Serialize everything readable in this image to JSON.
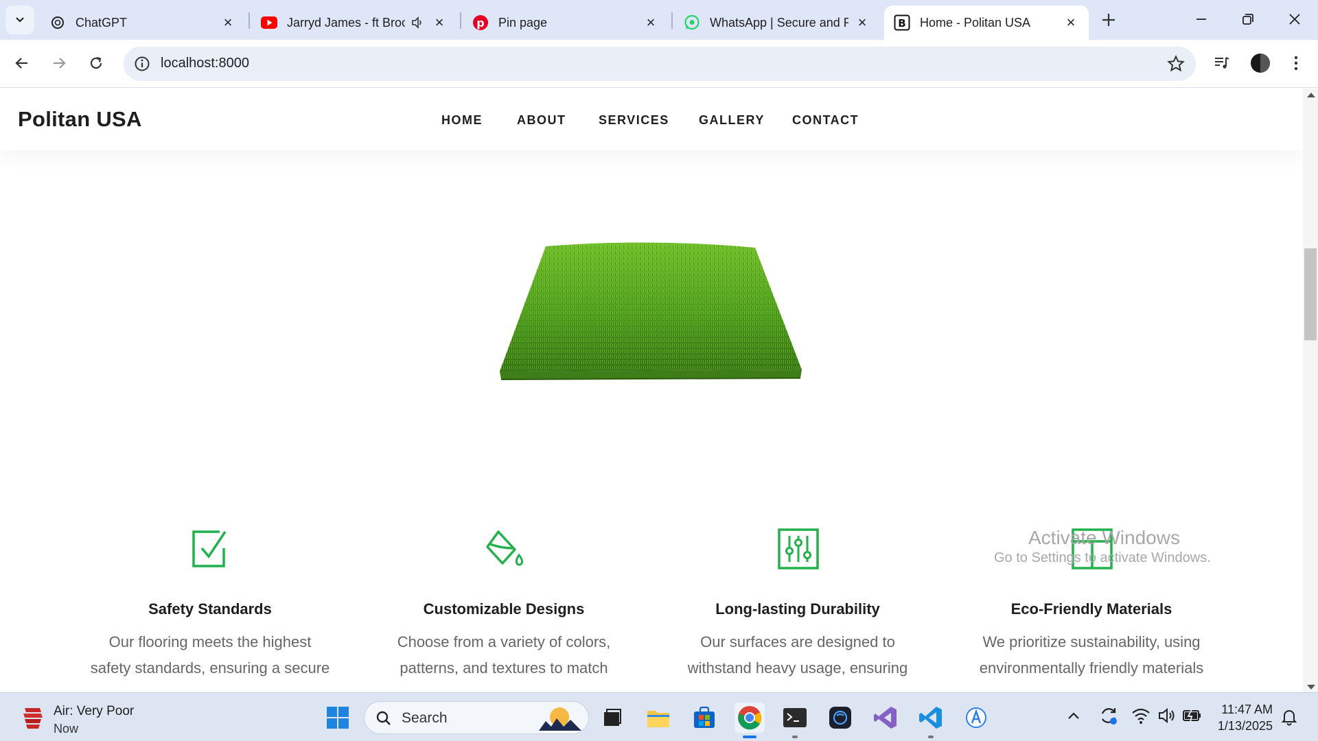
{
  "browser": {
    "tabs": [
      {
        "title": "ChatGPT",
        "favicon": "chatgpt-icon",
        "active": false
      },
      {
        "title": "Jarryd James - ft Broo",
        "favicon": "youtube-icon",
        "active": false,
        "audio": true
      },
      {
        "title": "Pin page",
        "favicon": "pinterest-icon",
        "active": false
      },
      {
        "title": "WhatsApp | Secure and R",
        "favicon": "whatsapp-icon",
        "active": false
      },
      {
        "title": "Home - Politan USA",
        "favicon": "bootstrap-icon",
        "active": true
      }
    ],
    "url": "localhost:8000"
  },
  "site": {
    "brand": "Politan USA",
    "nav": [
      "HOME",
      "ABOUT",
      "SERVICES",
      "GALLERY",
      "CONTACT"
    ],
    "accent_color": "#22b14c",
    "features": [
      {
        "icon": "checkbox-icon",
        "title": "Safety Standards",
        "lines": [
          "Our flooring meets the highest",
          "safety standards, ensuring a secure"
        ]
      },
      {
        "icon": "paint-bucket-icon",
        "title": "Customizable Designs",
        "lines": [
          "Choose from a variety of colors,",
          "patterns, and textures to match"
        ]
      },
      {
        "icon": "sliders-icon",
        "title": "Long-lasting Durability",
        "lines": [
          "Our surfaces are designed to",
          "withstand heavy usage, ensuring"
        ]
      },
      {
        "icon": "layout-icon",
        "title": "Eco-Friendly Materials",
        "lines": [
          "We prioritize sustainability, using",
          "environmentally friendly materials"
        ]
      }
    ]
  },
  "watermark": {
    "line1": "Activate Windows",
    "line2": "Go to Settings to activate Windows."
  },
  "taskbar": {
    "weather_title": "Air: Very Poor",
    "weather_sub": "Now",
    "search_placeholder": "Search",
    "time": "11:47 AM",
    "date": "1/13/2025"
  }
}
